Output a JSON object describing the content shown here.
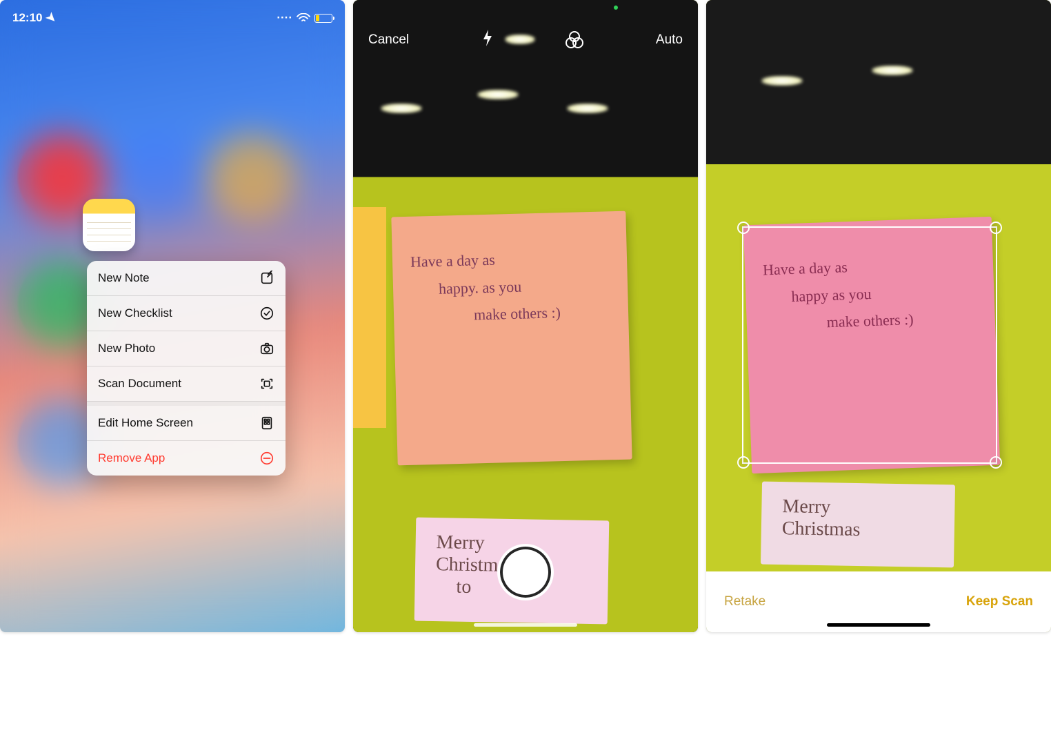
{
  "status": {
    "time": "12:10",
    "location_arrow": "➤",
    "dots": "····",
    "wifi": "wifi"
  },
  "notes_icon": "Notes",
  "context_menu": [
    {
      "label": "New Note",
      "icon": "compose-icon"
    },
    {
      "label": "New Checklist",
      "icon": "checkmark-circle-icon"
    },
    {
      "label": "New Photo",
      "icon": "camera-icon"
    },
    {
      "label": "Scan Document",
      "icon": "scan-icon"
    },
    {
      "label": "Edit Home Screen",
      "icon": "apps-icon",
      "sep": true
    },
    {
      "label": "Remove App",
      "icon": "minus-circle-icon",
      "destructive": true
    }
  ],
  "scanner": {
    "cancel": "Cancel",
    "mode": "Auto",
    "note_line1": "Have a day as",
    "note_line2": "happy. as you",
    "note_line3": "make others :)",
    "note2_line1": "Merry",
    "note2_line2": "Christmas",
    "note2_line3": "to"
  },
  "review": {
    "retake": "Retake",
    "keep": "Keep Scan",
    "note_line1": "Have a day as",
    "note_line2": "happy as you",
    "note_line3": "make others :)",
    "note2_line1": "Merry",
    "note2_line2": "Christmas"
  }
}
